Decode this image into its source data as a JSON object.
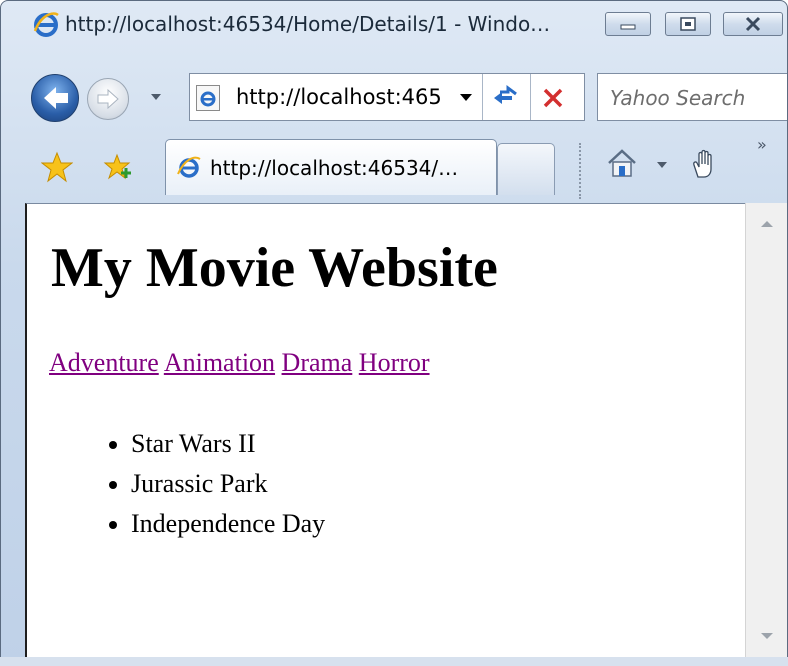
{
  "window": {
    "title": "http://localhost:46534/Home/Details/1 - Windo…"
  },
  "navbar": {
    "address_text": "http://localhost:465",
    "search_placeholder": "Yahoo Search"
  },
  "tabs": [
    {
      "label": "http://localhost:46534/…",
      "active": true
    }
  ],
  "page": {
    "heading": "My Movie Website",
    "genres": [
      "Adventure",
      "Animation",
      "Drama",
      "Horror"
    ],
    "movies": [
      "Star Wars II",
      "Jurassic Park",
      "Independence Day"
    ]
  },
  "colors": {
    "visited_link": "#800080",
    "ie_blue": "#2a6ec8"
  }
}
